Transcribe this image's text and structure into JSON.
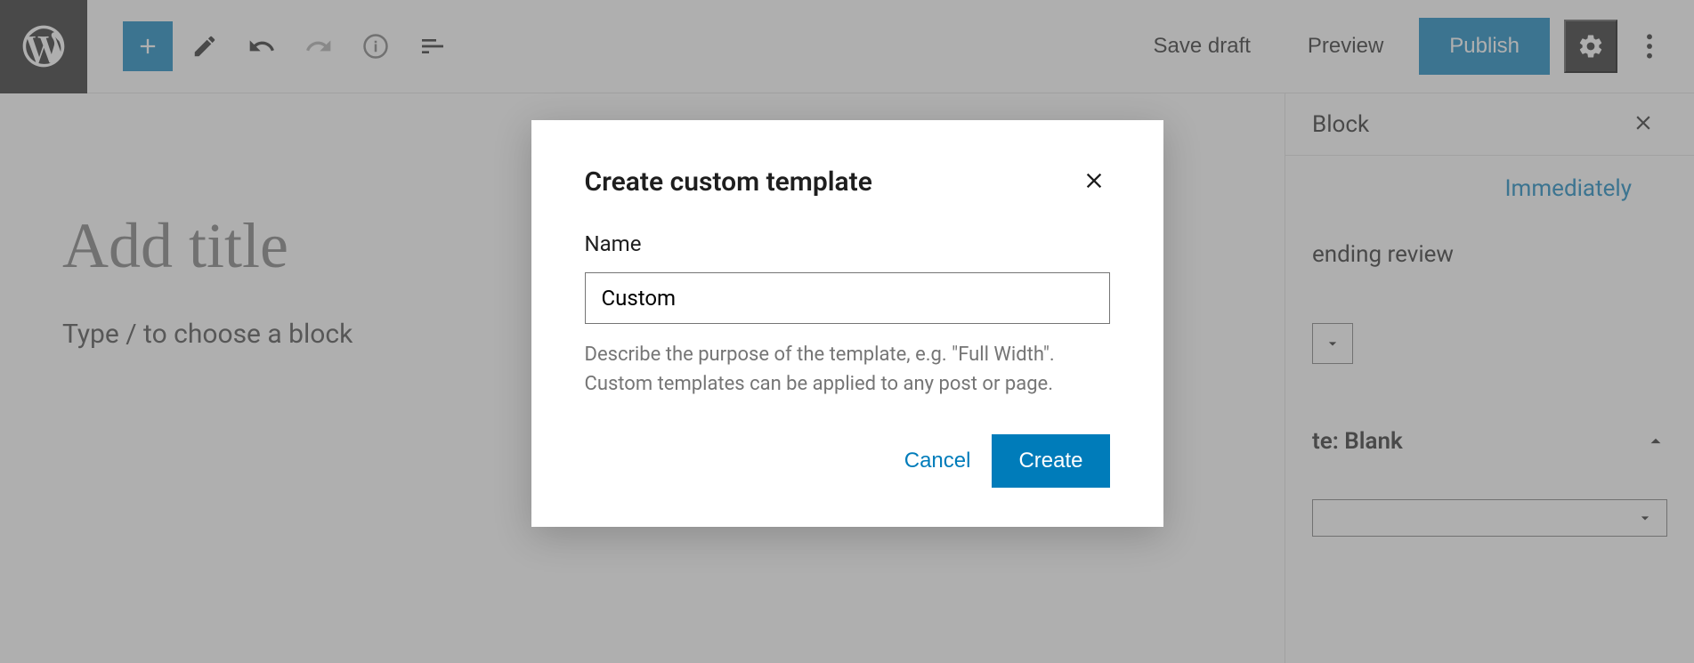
{
  "toolbar": {
    "save_draft": "Save draft",
    "preview": "Preview",
    "publish": "Publish"
  },
  "editor": {
    "title_placeholder": "Add title",
    "block_placeholder": "Type / to choose a block"
  },
  "sidebar": {
    "tab_block": "Block",
    "immediately": "Immediately",
    "pending_review": "ending review",
    "template_label": "te: Blank"
  },
  "modal": {
    "title": "Create custom template",
    "name_label": "Name",
    "name_value": "Custom",
    "description": "Describe the purpose of the template, e.g. \"Full Width\". Custom templates can be applied to any post or page.",
    "cancel": "Cancel",
    "create": "Create"
  }
}
